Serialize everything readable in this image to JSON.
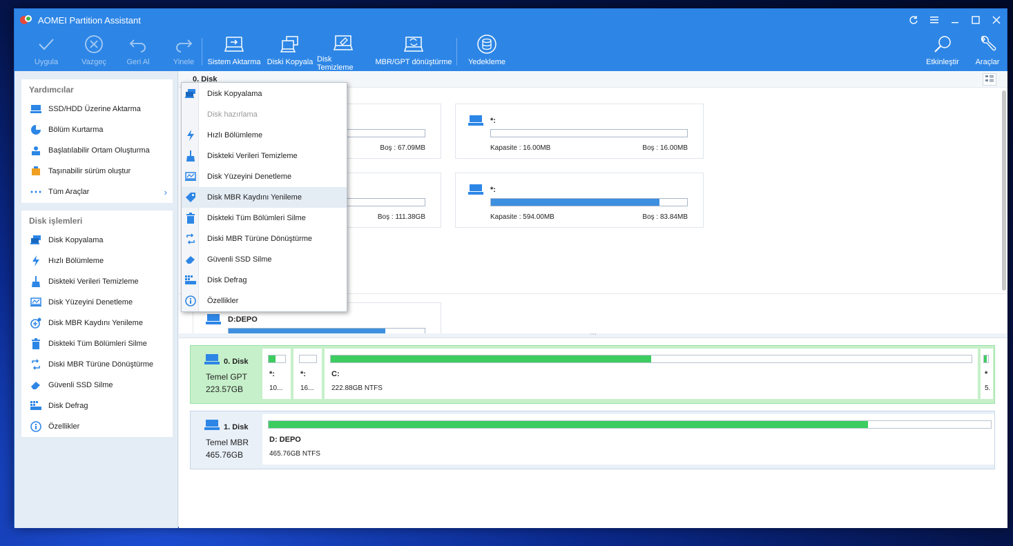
{
  "window": {
    "title": "AOMEI Partition Assistant"
  },
  "toolbar": {
    "apply": "Uygula",
    "undo": "Vazgeç",
    "back": "Geri Al",
    "redo": "Yinele",
    "migrate_os": "Sistem Aktarma",
    "clone_disk": "Diski Kopyala",
    "wipe_disk": "Disk Temizleme",
    "mbr_gpt": "MBR/GPT dönüştürme",
    "backup": "Yedekleme",
    "activate": "Etkinleştir",
    "tools": "Araçlar"
  },
  "sidebar": {
    "wizards_title": "Yardımcılar",
    "wizards": [
      "SSD/HDD Üzerine Aktarma",
      "Bölüm Kurtarma",
      "Başlatılabilir Ortam Oluşturma",
      "Taşınabilir sürüm oluştur",
      "Tüm Araçlar"
    ],
    "disk_ops_title": "Disk işlemleri",
    "disk_ops": [
      "Disk Kopyalama",
      "Hızlı Bölümleme",
      "Diskteki Verileri Temizleme",
      "Disk Yüzeyini Denetleme",
      "Disk MBR Kaydını Yenileme",
      "Diskteki Tüm Bölümleri Silme",
      "Diski MBR Türüne Dönüştürme",
      "Güvenli SSD Silme",
      "Disk Defrag",
      "Özellikler"
    ]
  },
  "main": {
    "disk0_header": "0. Disk",
    "disk1_header_partial": "1",
    "cards": [
      {
        "free": "Boş : 67.09MB",
        "used": 0.3
      },
      {
        "name": "*:",
        "capacity": "Kapasite : 16.00MB",
        "free": "Boş : 16.00MB",
        "used": 0.0
      },
      {
        "free": "Boş : 111.38GB",
        "used": 0.5
      },
      {
        "name": "*:",
        "capacity": "Kapasite : 594.00MB",
        "free": "Boş : 83.84MB",
        "used": 0.86
      },
      {
        "name": "D:DEPO",
        "used": 0.8
      }
    ]
  },
  "context_menu": {
    "items": [
      "Disk Kopyalama",
      "Disk hazırlama",
      "Hızlı Bölümleme",
      "Diskteki Verileri Temizleme",
      "Disk Yüzeyini Denetleme",
      "Disk MBR Kaydını Yenileme",
      "Diskteki Tüm Bölümleri Silme",
      "Diski MBR Türüne Dönüştürme",
      "Güvenli SSD Silme",
      "Disk Defrag",
      "Özellikler"
    ],
    "disabled": [
      1
    ],
    "hover": 5
  },
  "disk_map": {
    "disk0": {
      "name": "0. Disk",
      "type": "Temel GPT",
      "size": "223.57GB",
      "accent": "#c6f0c9",
      "partitions": [
        {
          "name": "*:",
          "info": "10...",
          "used": 0.4
        },
        {
          "name": "*:",
          "info": "16...",
          "used": 0.0
        },
        {
          "name": "C:",
          "info": "222.88GB NTFS",
          "used": 0.5
        },
        {
          "name": "*",
          "info": "5.",
          "used": 0.6
        }
      ]
    },
    "disk1": {
      "name": "1. Disk",
      "type": "Temel MBR",
      "size": "465.76GB",
      "accent": "#e9f0f8",
      "partitions": [
        {
          "name": "D: DEPO",
          "info": "465.76GB NTFS",
          "used": 0.83
        }
      ]
    }
  },
  "colors": {
    "accent": "#2d86e6",
    "used_bar": "#3ccc60",
    "card_bar": "#3d8fe0"
  }
}
